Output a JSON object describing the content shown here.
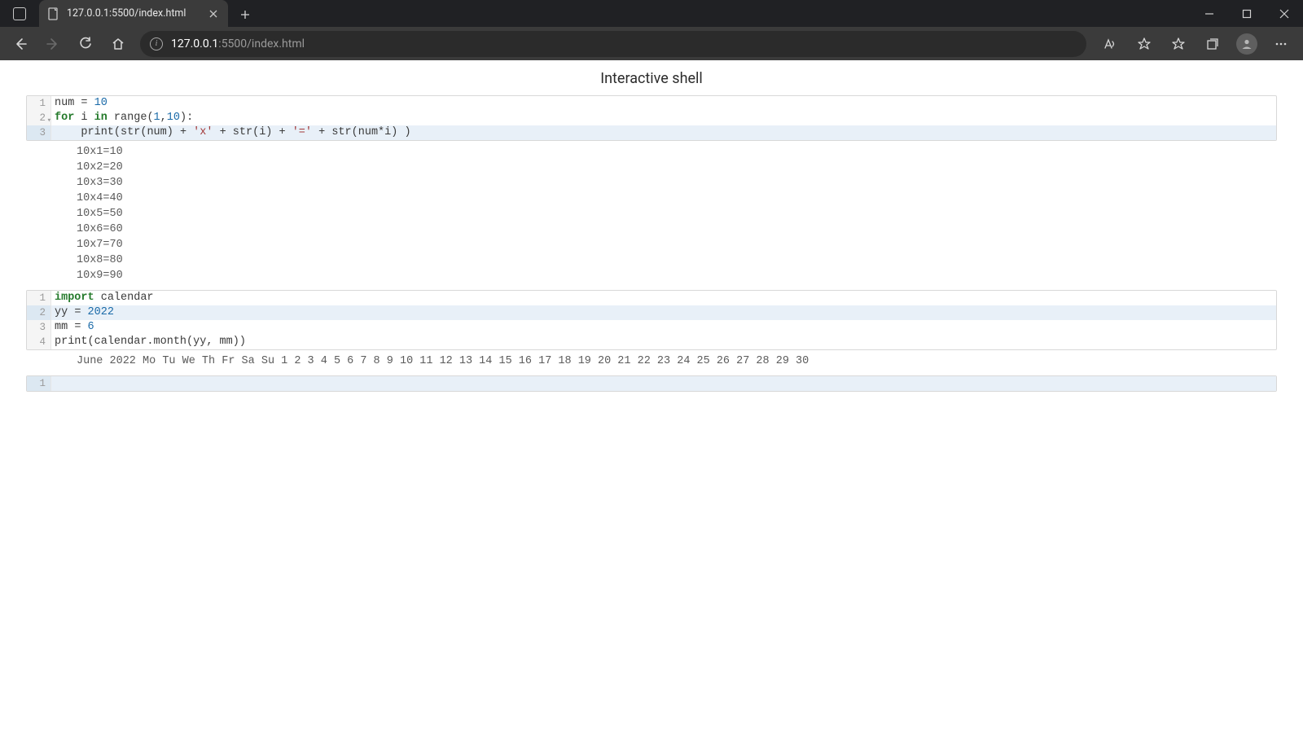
{
  "browser": {
    "tab_title": "127.0.0.1:5500/index.html",
    "url_host": "127.0.0.1",
    "url_rest": ":5500/index.html"
  },
  "page": {
    "title": "Interactive shell"
  },
  "cells": [
    {
      "lines": [
        {
          "n": "1",
          "active": false,
          "fold": false,
          "tokens": [
            {
              "t": "num ",
              "c": "var"
            },
            {
              "t": "= ",
              "c": "op"
            },
            {
              "t": "10",
              "c": "num"
            }
          ]
        },
        {
          "n": "2",
          "active": false,
          "fold": true,
          "tokens": [
            {
              "t": "for ",
              "c": "kw"
            },
            {
              "t": "i ",
              "c": "var"
            },
            {
              "t": "in ",
              "c": "kw"
            },
            {
              "t": "range",
              "c": "builtin"
            },
            {
              "t": "(",
              "c": "op"
            },
            {
              "t": "1",
              "c": "num"
            },
            {
              "t": ",",
              "c": "op"
            },
            {
              "t": "10",
              "c": "num"
            },
            {
              "t": "):",
              "c": "op"
            }
          ]
        },
        {
          "n": "3",
          "active": true,
          "fold": false,
          "tokens": [
            {
              "t": "    ",
              "c": "op"
            },
            {
              "t": "print",
              "c": "builtin"
            },
            {
              "t": "(",
              "c": "op"
            },
            {
              "t": "str",
              "c": "builtin"
            },
            {
              "t": "(num) + ",
              "c": "op"
            },
            {
              "t": "'x'",
              "c": "str"
            },
            {
              "t": " + ",
              "c": "op"
            },
            {
              "t": "str",
              "c": "builtin"
            },
            {
              "t": "(i) + ",
              "c": "op"
            },
            {
              "t": "'='",
              "c": "str"
            },
            {
              "t": " + ",
              "c": "op"
            },
            {
              "t": "str",
              "c": "builtin"
            },
            {
              "t": "(num*i) )",
              "c": "op"
            }
          ]
        }
      ],
      "output": "10x1=10\n10x2=20\n10x3=30\n10x4=40\n10x5=50\n10x6=60\n10x7=70\n10x8=80\n10x9=90"
    },
    {
      "lines": [
        {
          "n": "1",
          "active": false,
          "fold": false,
          "tokens": [
            {
              "t": "import ",
              "c": "kw"
            },
            {
              "t": "calendar",
              "c": "var"
            }
          ]
        },
        {
          "n": "2",
          "active": true,
          "fold": false,
          "tokens": [
            {
              "t": "yy ",
              "c": "var"
            },
            {
              "t": "= ",
              "c": "op"
            },
            {
              "t": "2022",
              "c": "num"
            }
          ]
        },
        {
          "n": "3",
          "active": false,
          "fold": false,
          "tokens": [
            {
              "t": "mm ",
              "c": "var"
            },
            {
              "t": "= ",
              "c": "op"
            },
            {
              "t": "6",
              "c": "num"
            }
          ]
        },
        {
          "n": "4",
          "active": false,
          "fold": false,
          "tokens": [
            {
              "t": "print",
              "c": "builtin"
            },
            {
              "t": "(calendar.month(yy, mm))",
              "c": "op"
            }
          ]
        }
      ],
      "output": "June 2022 Mo Tu We Th Fr Sa Su 1 2 3 4 5 6 7 8 9 10 11 12 13 14 15 16 17 18 19 20 21 22 23 24 25 26 27 28 29 30"
    },
    {
      "lines": [
        {
          "n": "1",
          "active": true,
          "fold": false,
          "tokens": []
        }
      ],
      "output": null
    }
  ]
}
